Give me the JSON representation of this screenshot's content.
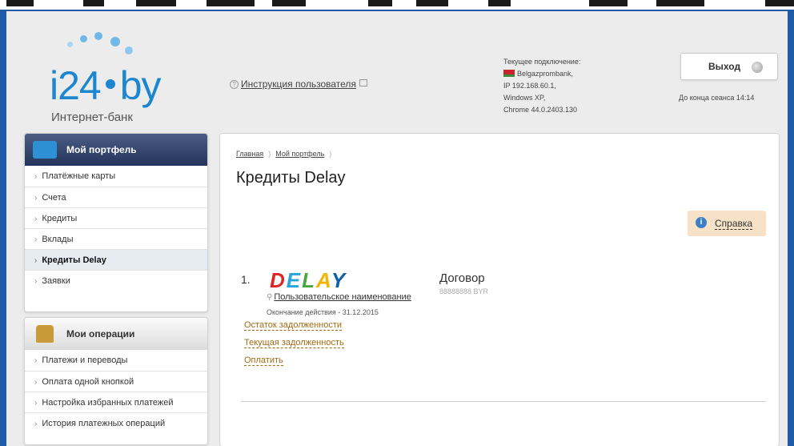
{
  "colors": {
    "accent": "#1c86d0",
    "sidebar_header": "#2b3b61",
    "link_gold": "#a06a14",
    "help_bg": "#f7e2c8"
  },
  "header": {
    "logo_text": "i24",
    "logo_suffix": "by",
    "logo_subtitle": "Интернет-банк",
    "instructions_link": "Инструкция пользователя",
    "connection": {
      "title": "Текущее подключение:",
      "bank": "Belgazprombank,",
      "ip": "IP 192.168.60.1,",
      "os": "Windows XP,",
      "browser": "Chrome 44.0.2403.130"
    },
    "logout_label": "Выход",
    "session_text": "До конца сеанса 14:14"
  },
  "sidebar": {
    "portfolio_title": "Мой портфель",
    "portfolio_items": [
      {
        "label": "Платёжные карты",
        "active": false
      },
      {
        "label": "Счета",
        "active": false
      },
      {
        "label": "Кредиты",
        "active": false
      },
      {
        "label": "Вклады",
        "active": false
      },
      {
        "label": "Кредиты Delay",
        "active": true
      },
      {
        "label": "Заявки",
        "active": false
      }
    ],
    "operations_title": "Мои операции",
    "operations_items": [
      {
        "label": "Платежи и переводы"
      },
      {
        "label": "Оплата одной кнопкой"
      },
      {
        "label": "Настройка избранных платежей"
      },
      {
        "label": "История платежных операций"
      }
    ]
  },
  "main": {
    "breadcrumbs": [
      "Главная",
      "Мой портфель"
    ],
    "title": "Кредиты Delay",
    "help_label": "Справка",
    "credit": {
      "index": "1.",
      "brand_letters": [
        "D",
        "E",
        "L",
        "A",
        "Y"
      ],
      "user_name_label": "Пользовательское наименование",
      "expiry": "Окончание действия - 31.12.2015",
      "contract_label": "Договор",
      "account": "88888888 BYR",
      "links": [
        "Остаток задолженности",
        "Текущая задолженность",
        "Оплатить"
      ]
    }
  }
}
